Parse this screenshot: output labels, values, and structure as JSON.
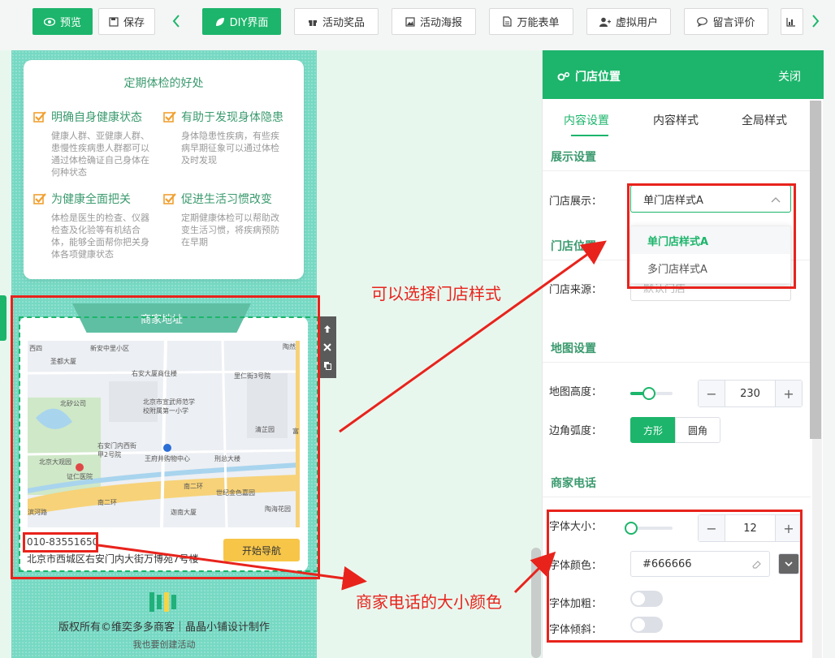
{
  "toolbar": {
    "preview": "预览",
    "save": "保存",
    "diy": "DIY界面",
    "prize": "活动奖品",
    "poster": "活动海报",
    "form": "万能表单",
    "virtual_user": "虚拟用户",
    "comment": "留言评价"
  },
  "benefits": {
    "title": "定期体检的好处",
    "items": [
      {
        "head": "明确自身健康状态",
        "desc": "健康人群、亚健康人群、患慢性疾病患人群都可以通过体检确证自己身体在何种状态"
      },
      {
        "head": "有助于发现身体隐患",
        "desc": "身体隐患性疾病，有些疾病早期征象可以通过体检及时发现"
      },
      {
        "head": "为健康全面把关",
        "desc": "体检是医生的检查、仪器检查及化验等有机结合体，能够全面帮你把关身体各项健康状态"
      },
      {
        "head": "促进生活习惯改变",
        "desc": "定期健康体检可以帮助改变生活习惯，将疾病预防在早期"
      }
    ]
  },
  "store": {
    "banner": "商家地址",
    "phone": "010-83551650",
    "address": "北京市西城区右安门内大街万博苑7号楼",
    "nav_button": "开始导航"
  },
  "map_labels": [
    "西四",
    "新安中里小区",
    "陶然",
    "圣都大厦",
    "右安大厦商住楼",
    "里仁街3号院",
    "北京市宣武师范学校附属第一小学",
    "北矽公司",
    "清芷园",
    "右安门内西街甲2号院",
    "王府井购物中心",
    "北京大观园",
    "刑总大楼",
    "证仁医院",
    "南二环",
    "南二环",
    "世纪金色嘉园",
    "迦南大厦",
    "陶海花园",
    "滨河路",
    "富"
  ],
  "footer": {
    "copyright": "版权所有©维奕多多商客｜晶晶小铺设计制作",
    "create": "我也要创建活动"
  },
  "annotations": {
    "store_style": "可以选择门店样式",
    "phone_style": "商家电话的大小颜色"
  },
  "panel": {
    "title": "门店位置",
    "close": "关闭",
    "tabs": [
      "内容设置",
      "内容样式",
      "全局样式"
    ],
    "display_section": "展示设置",
    "store_display_label": "门店展示：",
    "store_display_value": "单门店样式A",
    "dropdown_options": [
      "单门店样式A",
      "多门店样式A"
    ],
    "location_section": "门店位置",
    "source_label": "门店来源：",
    "source_value": "默认门店",
    "map_section": "地图设置",
    "map_height_label": "地图高度：",
    "map_height_value": "230",
    "radius_label": "边角弧度：",
    "radius_options": [
      "方形",
      "圆角"
    ],
    "phone_section": "商家电话",
    "font_size_label": "字体大小：",
    "font_size_value": "12",
    "font_color_label": "字体颜色：",
    "font_color_value": "#666666",
    "bold_label": "字体加粗：",
    "italic_label": "字体倾斜："
  },
  "colors": {
    "accent": "#1cb56b",
    "annotation": "#e8231c",
    "phone_bg": "#76d9c3"
  }
}
